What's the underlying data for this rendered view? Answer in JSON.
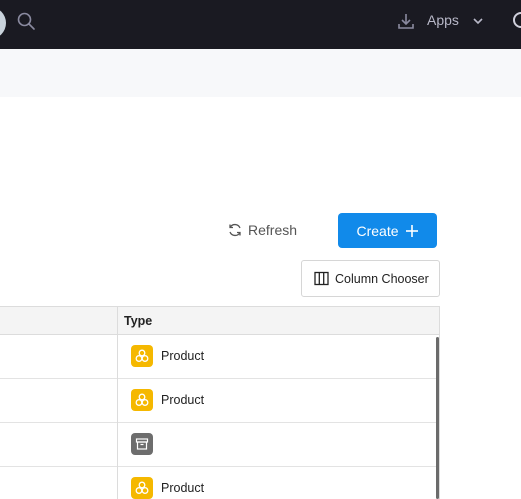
{
  "nav": {
    "apps_label": "Apps"
  },
  "toolbar": {
    "refresh_label": "Refresh",
    "create_label": "Create",
    "column_chooser_label": "Column Chooser"
  },
  "table": {
    "columns": [
      "Type"
    ],
    "rows": [
      {
        "type_label": "Product",
        "icon": "product-icon"
      },
      {
        "type_label": "Product",
        "icon": "product-icon"
      },
      {
        "type_label": "",
        "icon": "archive-icon"
      },
      {
        "type_label": "Product",
        "icon": "product-icon"
      }
    ]
  },
  "colors": {
    "nav_bg": "#1a1a22",
    "accent": "#118aea",
    "product_badge": "#f5b800",
    "archive_badge": "#6d6d6d"
  }
}
